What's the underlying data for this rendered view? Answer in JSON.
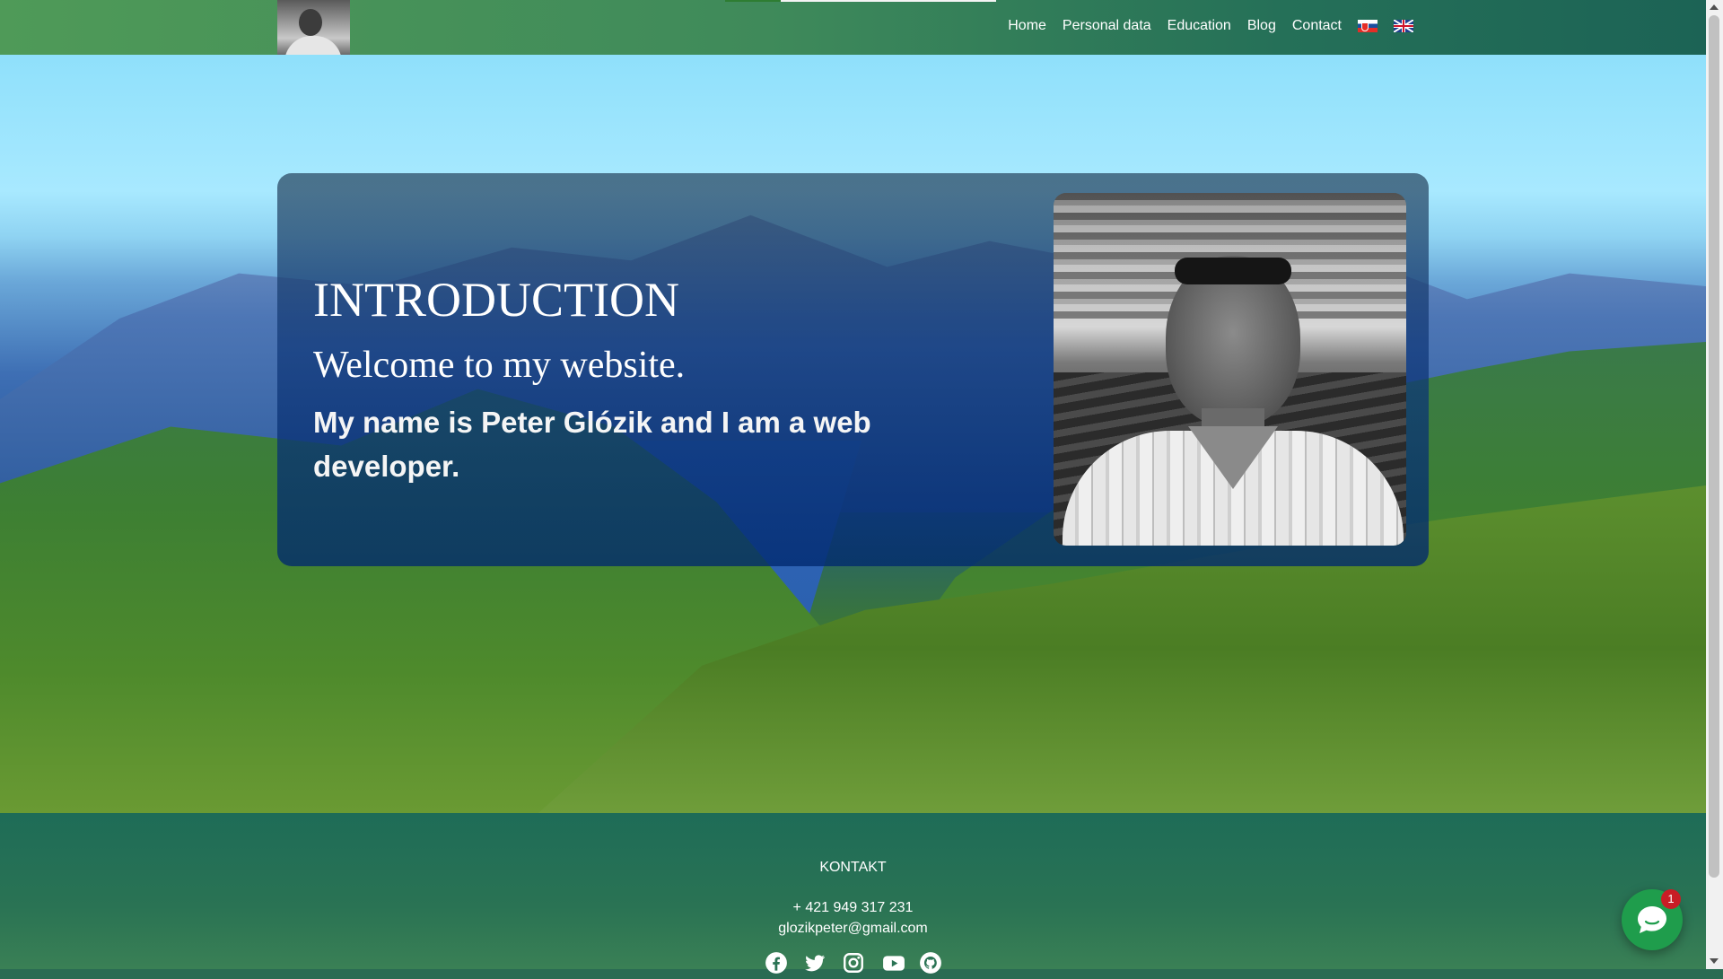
{
  "nav": {
    "links": [
      "Home",
      "Personal data",
      "Education",
      "Blog",
      "Contact"
    ],
    "flags": [
      "slovak-flag-icon",
      "uk-flag-icon"
    ]
  },
  "intro": {
    "title": "INTRODUCTION",
    "welcome": "Welcome to my website.",
    "text": "My name is Peter Glózik and I am a web developer."
  },
  "footer": {
    "heading": "KONTAKT",
    "phone": "+ 421 949 317 231",
    "email": "glozikpeter@gmail.com",
    "social_icons": [
      "facebook-icon",
      "twitter-icon",
      "instagram-icon",
      "youtube-icon",
      "github-icon"
    ]
  },
  "chat": {
    "badge": "1",
    "icon": "chat-bubble-icon",
    "color": "#1f9d4c"
  },
  "colors": {
    "header_green": "#4f9a58",
    "footer_green": "#1e6c57",
    "card_blue": "#0f3778"
  }
}
